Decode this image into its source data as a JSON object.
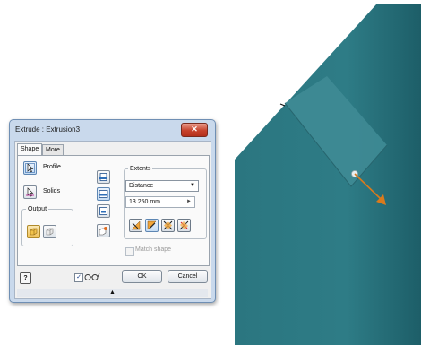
{
  "window_title": "Extrude : Extrusion3",
  "close_symbol": "✕",
  "tabs": [
    {
      "label": "Shape"
    },
    {
      "label": "More"
    }
  ],
  "shape": {
    "profile_label": "Profile",
    "solids_label": "Solids",
    "output_label": "Output",
    "extents_label": "Extents",
    "extents_select": "Distance",
    "distance_value": "13.250 mm",
    "match_shape_label": "Match shape",
    "match_shape_checked": false
  },
  "footer": {
    "help_symbol": "?",
    "preview_checked_symbol": "✓",
    "ok_label": "OK",
    "cancel_label": "Cancel",
    "expander_symbol": "▲"
  },
  "icons": {
    "profile": "cursor-profile-icon",
    "solids": "cursor-solids-icon",
    "output_solid": "solid-output-icon",
    "output_surface": "surface-output-icon",
    "operation_join": "join-icon",
    "operation_cut": "cut-icon",
    "operation_intersect": "intersect-icon",
    "operation_new_solid": "new-solid-icon",
    "direction_1": "direction-1-icon",
    "direction_2": "direction-2-icon",
    "direction_symmetric": "symmetric-icon",
    "direction_asymmetric": "asymmetric-icon",
    "preview": "glasses-icon"
  },
  "colors": {
    "part_body": "#2f7c86",
    "part_face_selected": "#3e8a94",
    "arrow": "#d97a1c",
    "dialog_frame": "#c9d9ec",
    "close_button": "#c6412b",
    "active_button_bg": "#cfe3f7"
  }
}
